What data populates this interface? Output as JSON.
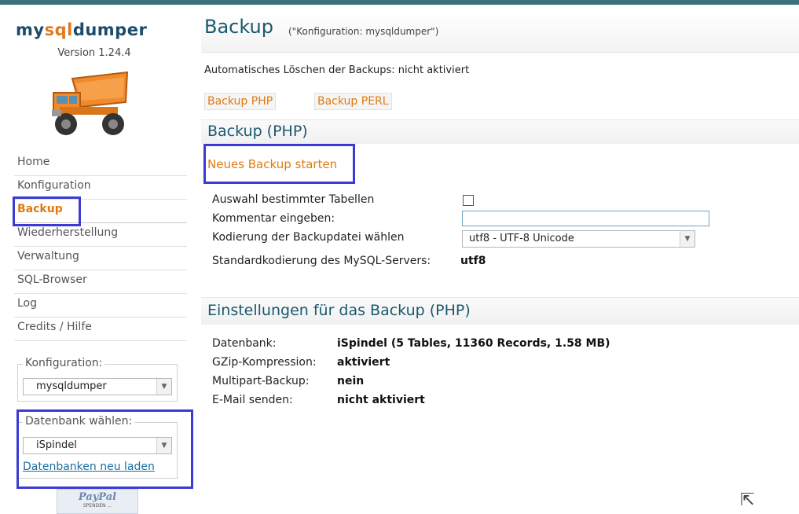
{
  "sidebar": {
    "logo": {
      "part1": "my",
      "part2": "sql",
      "part3": "dumper"
    },
    "version": "Version 1.24.4",
    "nav": [
      {
        "label": "Home"
      },
      {
        "label": "Konfiguration"
      },
      {
        "label": "Backup"
      },
      {
        "label": "Wiederherstellung"
      },
      {
        "label": "Verwaltung"
      },
      {
        "label": "SQL-Browser"
      },
      {
        "label": "Log"
      },
      {
        "label": "Credits / Hilfe"
      }
    ],
    "config_legend": "Konfiguration:",
    "config_value": "mysqldumper",
    "db_legend": "Datenbank wählen:",
    "db_value": "iSpindel",
    "reload_label": "Datenbanken neu laden",
    "paypal_label": "PayPal",
    "paypal_sub": "SPENDEN ..."
  },
  "header": {
    "title": "Backup",
    "subtitle": "(\"Konfiguration: mysqldumper\")"
  },
  "auto_delete": "Automatisches Löschen der Backups: nicht aktiviert",
  "buttons": {
    "php": "Backup PHP",
    "perl": "Backup PERL"
  },
  "backup_php": {
    "title": "Backup (PHP)",
    "start_link": "Neues Backup starten",
    "select_tables_label": "Auswahl bestimmter Tabellen",
    "comment_label": "Kommentar eingeben:",
    "comment_value": "",
    "encoding_label": "Kodierung der Backupdatei wählen",
    "encoding_value": "utf8 - UTF-8 Unicode",
    "server_encoding_label": "Standardkodierung des MySQL-Servers:",
    "server_encoding_value": "utf8"
  },
  "settings": {
    "title": "Einstellungen für das Backup (PHP)",
    "rows": [
      {
        "label": "Datenbank:",
        "value": "iSpindel  (5 Tables, 11360 Records, 1.58 MB)"
      },
      {
        "label": "GZip-Kompression:",
        "value": "aktiviert"
      },
      {
        "label": "Multipart-Backup:",
        "value": "nein"
      },
      {
        "label": "E-Mail senden:",
        "value": "nicht aktiviert"
      }
    ]
  },
  "colors": {
    "accent": "#e07a10",
    "heading": "#1b5870",
    "highlight": "#3a3ad6"
  }
}
